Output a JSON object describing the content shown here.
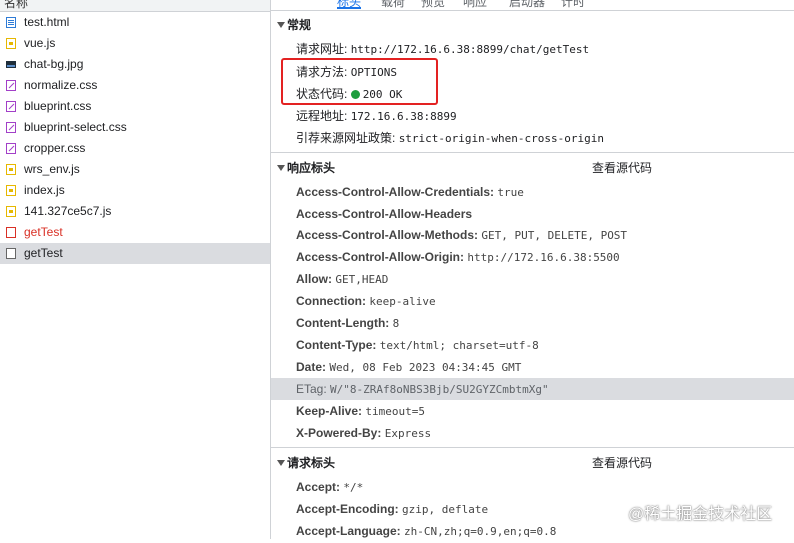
{
  "left_header": "名称",
  "files": [
    {
      "name": "test.html",
      "icon": "html-file-icon",
      "type": "html"
    },
    {
      "name": "vue.js",
      "icon": "js-file-icon",
      "type": "js"
    },
    {
      "name": "chat-bg.jpg",
      "icon": "image-file-icon",
      "type": "img"
    },
    {
      "name": "normalize.css",
      "icon": "css-file-icon",
      "type": "css"
    },
    {
      "name": "blueprint.css",
      "icon": "css-file-icon",
      "type": "css"
    },
    {
      "name": "blueprint-select.css",
      "icon": "css-file-icon",
      "type": "css"
    },
    {
      "name": "cropper.css",
      "icon": "css-file-icon",
      "type": "css"
    },
    {
      "name": "wrs_env.js",
      "icon": "js-file-icon",
      "type": "js"
    },
    {
      "name": "index.js",
      "icon": "js-file-icon",
      "type": "js"
    },
    {
      "name": "141.327ce5c7.js",
      "icon": "js-file-icon",
      "type": "js"
    },
    {
      "name": "getTest",
      "icon": "error-request-icon",
      "type": "err",
      "status": "error"
    },
    {
      "name": "getTest",
      "icon": "document-icon",
      "type": "doc",
      "selected": true
    }
  ],
  "tabs": [
    {
      "label": "标头",
      "active": true
    },
    {
      "label": "载荷"
    },
    {
      "label": "预览"
    },
    {
      "label": "响应"
    },
    {
      "label": "启动器"
    },
    {
      "label": "计时"
    }
  ],
  "general": {
    "title": "常规",
    "url_label": "请求网址:",
    "url": "http://172.16.6.38:8899/chat/getTest",
    "method_label": "请求方法:",
    "method": "OPTIONS",
    "status_label": "状态代码:",
    "status": "200 OK",
    "remote_label": "远程地址:",
    "remote": "172.16.6.38:8899",
    "referrer_label": "引荐来源网址政策:",
    "referrer": "strict-origin-when-cross-origin"
  },
  "response_headers": {
    "title": "响应标头",
    "view_source": "查看源代码",
    "items": [
      {
        "k": "Access-Control-Allow-Credentials:",
        "v": "true"
      },
      {
        "k": "Access-Control-Allow-Headers",
        "v": ""
      },
      {
        "k": "Access-Control-Allow-Methods:",
        "v": "GET, PUT, DELETE, POST"
      },
      {
        "k": "Access-Control-Allow-Origin:",
        "v": "http://172.16.6.38:5500"
      },
      {
        "k": "Allow:",
        "v": "GET,HEAD"
      },
      {
        "k": "Connection:",
        "v": "keep-alive"
      },
      {
        "k": "Content-Length:",
        "v": "8"
      },
      {
        "k": "Content-Type:",
        "v": "text/html; charset=utf-8"
      },
      {
        "k": "Date:",
        "v": "Wed, 08 Feb 2023 04:34:45 GMT"
      },
      {
        "k": "ETag:",
        "v": "W/\"8-ZRAf8oNBS3Bjb/SU2GYZCmbtmXg\"",
        "highlight": true
      },
      {
        "k": "Keep-Alive:",
        "v": "timeout=5"
      },
      {
        "k": "X-Powered-By:",
        "v": "Express"
      }
    ]
  },
  "request_headers": {
    "title": "请求标头",
    "view_source": "查看源代码",
    "items": [
      {
        "k": "Accept:",
        "v": "*/*"
      },
      {
        "k": "Accept-Encoding:",
        "v": "gzip, deflate"
      },
      {
        "k": "Accept-Language:",
        "v": "zh-CN,zh;q=0.9,en;q=0.8"
      }
    ]
  },
  "watermark": "@稀土掘金技术社区",
  "colors": {
    "accent": "#1a73e8",
    "error": "#d93025",
    "status_ok": "#1e9e3e",
    "highlight_box": "#e32222"
  }
}
